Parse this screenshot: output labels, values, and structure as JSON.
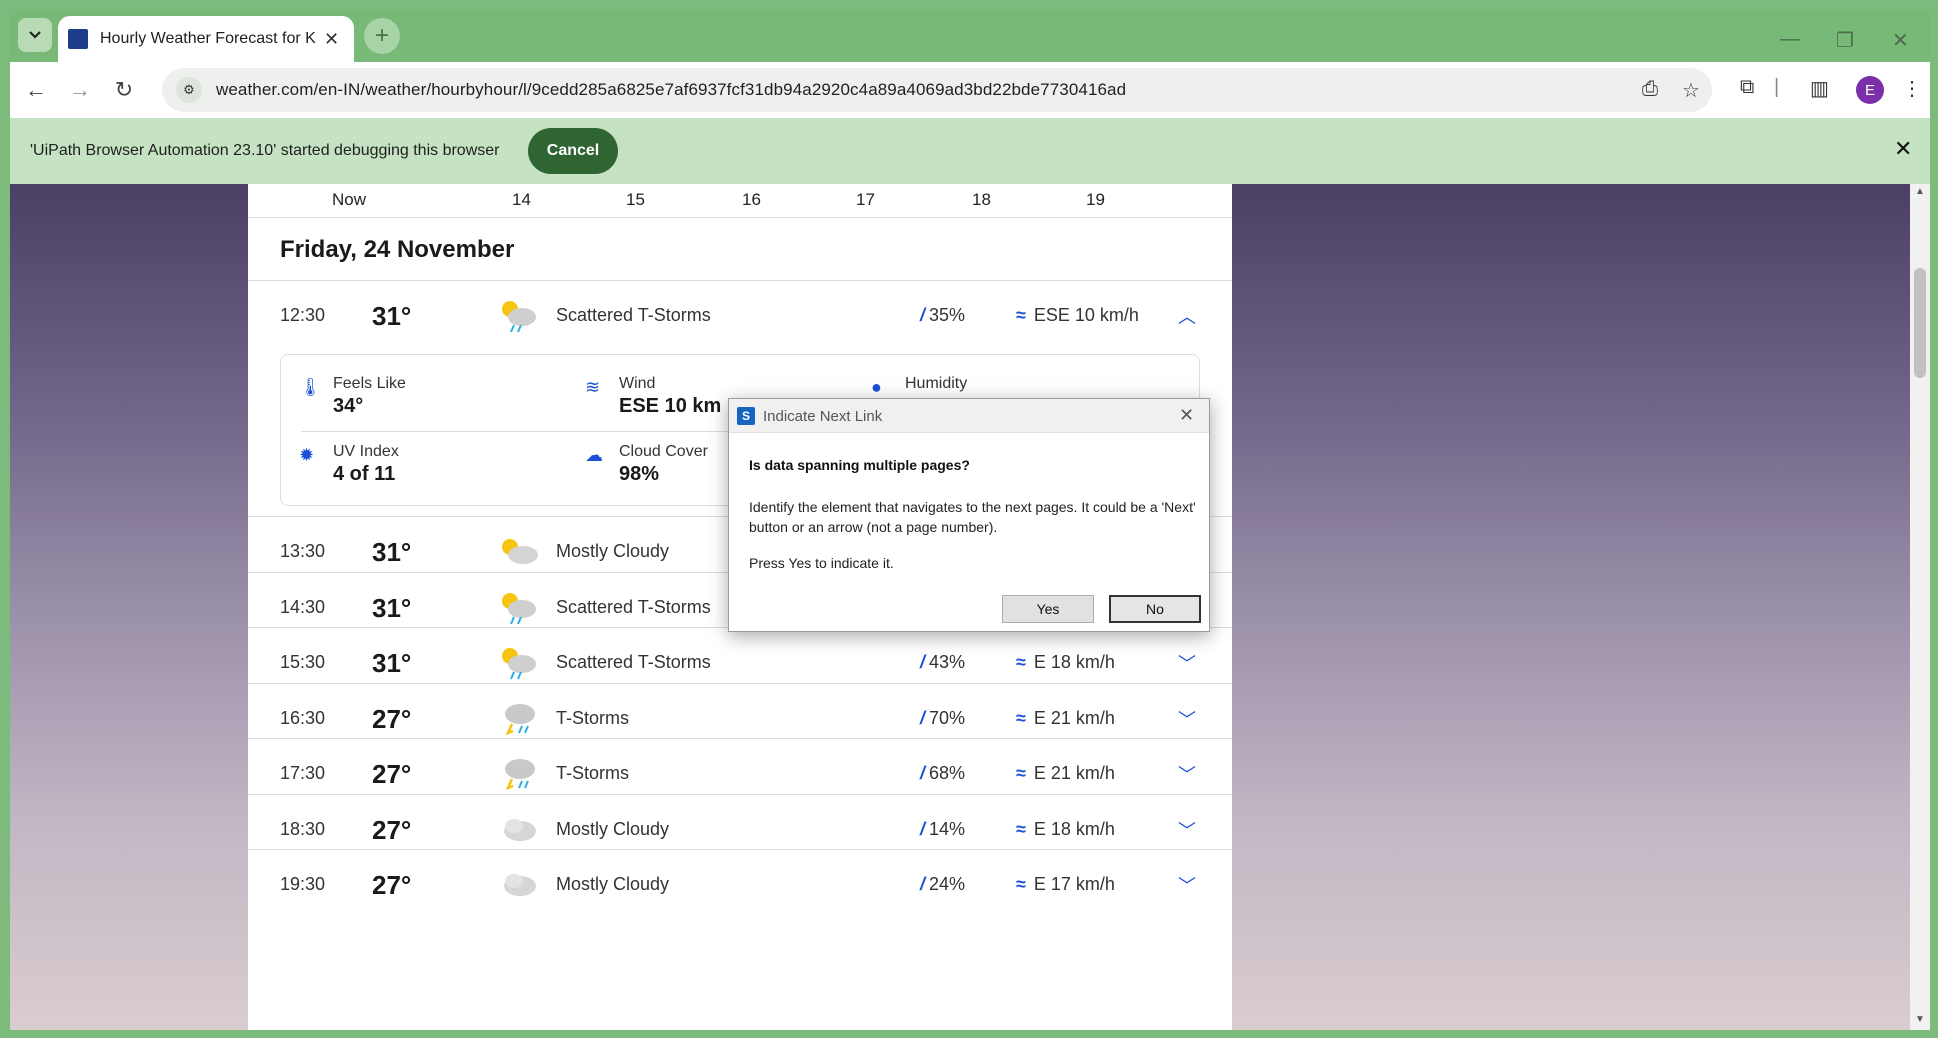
{
  "browser": {
    "tab_title": "Hourly Weather Forecast for K",
    "favicon_text": "The Weather Channel",
    "url": "weather.com/en-IN/weather/hourbyhour/l/9cedd285a6825e7af6937fcf31db94a2920c4a89a4069ad3bd22bde7730416ad",
    "avatar_letter": "E"
  },
  "infobar": {
    "message": "'UiPath Browser Automation 23.10' started debugging this browser",
    "cancel_label": "Cancel"
  },
  "forecast": {
    "hour_ticks": [
      "Now",
      "14",
      "15",
      "16",
      "17",
      "18",
      "19"
    ],
    "day_header": "Friday, 24 November",
    "expanded_row": {
      "time": "12:30",
      "temp": "31°",
      "condition": "Scattered T-Storms",
      "precip": "35%",
      "wind": "ESE 10 km/h",
      "icon": "thunderstorm-sun-icon"
    },
    "details": {
      "feels_like_label": "Feels Like",
      "feels_like_value": "34°",
      "wind_label": "Wind",
      "wind_value": "ESE 10 km",
      "humidity_label": "Humidity",
      "uv_label": "UV Index",
      "uv_value": "4 of 11",
      "cloud_label": "Cloud Cover",
      "cloud_value": "98%"
    },
    "rows": [
      {
        "time": "13:30",
        "temp": "31°",
        "condition": "Mostly Cloudy",
        "precip": "",
        "wind": "",
        "icon": "partly-cloudy-icon"
      },
      {
        "time": "14:30",
        "temp": "31°",
        "condition": "Scattered T-Storms",
        "precip": "39%",
        "wind": "E 12 km/h",
        "icon": "thunderstorm-sun-icon"
      },
      {
        "time": "15:30",
        "temp": "31°",
        "condition": "Scattered T-Storms",
        "precip": "43%",
        "wind": "E 18 km/h",
        "icon": "thunderstorm-sun-icon"
      },
      {
        "time": "16:30",
        "temp": "27°",
        "condition": "T-Storms",
        "precip": "70%",
        "wind": "E 21 km/h",
        "icon": "thunderstorm-icon"
      },
      {
        "time": "17:30",
        "temp": "27°",
        "condition": "T-Storms",
        "precip": "68%",
        "wind": "E 21 km/h",
        "icon": "thunderstorm-icon"
      },
      {
        "time": "18:30",
        "temp": "27°",
        "condition": "Mostly Cloudy",
        "precip": "14%",
        "wind": "E 18 km/h",
        "icon": "cloudy-icon"
      },
      {
        "time": "19:30",
        "temp": "27°",
        "condition": "Mostly Cloudy",
        "precip": "24%",
        "wind": "E 17 km/h",
        "icon": "cloudy-icon"
      }
    ]
  },
  "dialog": {
    "title": "Indicate Next Link",
    "question": "Is data spanning multiple pages?",
    "body": "Identify the element that navigates to the next pages. It could be a 'Next' button or an arrow (not a page number).",
    "press": "Press Yes to indicate it.",
    "yes_label": "Yes",
    "no_label": "No"
  },
  "colors": {
    "accent_blue": "#1a4fd6",
    "browser_green": "#7dbb7c",
    "cancel_green": "#2f6533"
  }
}
